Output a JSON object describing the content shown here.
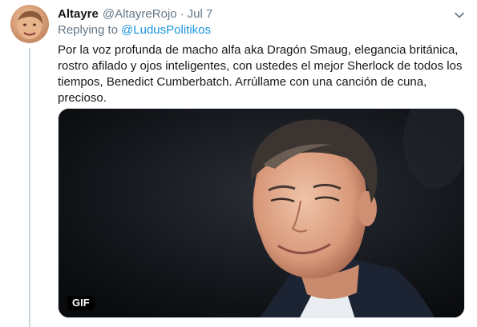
{
  "tweet": {
    "display_name": "Altayre",
    "handle": "@AltayreRojo",
    "separator": "·",
    "date": "Jul 7",
    "replying_prefix": "Replying to",
    "replying_to": "@LudusPolitikos",
    "text": "Por la voz profunda de macho alfa aka Dragón Smaug, elegancia británica, rostro afilado y ojos inteligentes, con ustedes el mejor Sherlock de todos los tiempos, Benedict Cumberbatch. Arrúllame con una canción de cuna, precioso.",
    "media": {
      "badge": "GIF"
    }
  },
  "colors": {
    "link": "#1b95e0",
    "secondary_text": "#657786",
    "primary_text": "#14171a",
    "thread_line": "#ccd6dd"
  },
  "icons": {
    "caret": "chevron-down-icon"
  }
}
